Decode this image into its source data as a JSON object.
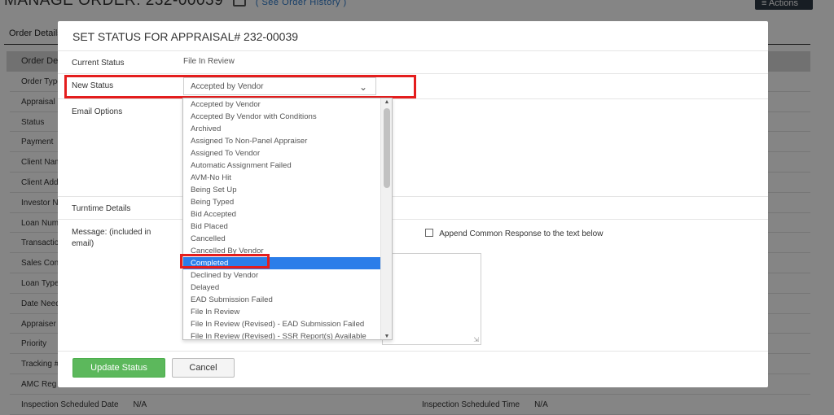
{
  "background": {
    "title": "MANAGE ORDER: 232-00039",
    "see_history": "( See Order History )",
    "actions_label": "≡  Actions",
    "tab": "Order Details",
    "section": "Order Details",
    "rows": [
      {
        "label": "Order Type"
      },
      {
        "label": "Appraisal"
      },
      {
        "label": "Status"
      },
      {
        "label": "Payment"
      },
      {
        "label": "Client Name"
      },
      {
        "label": "Client Address"
      },
      {
        "label": "Investor Name"
      },
      {
        "label": "Loan Number"
      },
      {
        "label": "Transaction"
      },
      {
        "label": "Sales Contract"
      },
      {
        "label": "Loan Type"
      },
      {
        "label": "Date Needed"
      },
      {
        "label": "Appraiser"
      },
      {
        "label": "Priority"
      },
      {
        "label": "Tracking #"
      },
      {
        "label": "AMC Reg"
      },
      {
        "label": "Inspection Scheduled Date",
        "value": "N/A",
        "right_label": "Inspection Scheduled Time",
        "right_value": "N/A"
      }
    ]
  },
  "modal": {
    "title": "SET STATUS FOR APPRAISAL# 232-00039",
    "current_status_label": "Current Status",
    "current_status_value": "File In Review",
    "new_status_label": "New Status",
    "new_status_selected": "Accepted by Vendor",
    "email_options_label": "Email Options",
    "turntime_label": "Turntime Details",
    "message_label": "Message: (included in email)",
    "append_label": "Append Common Response to the text below",
    "update_button": "Update Status",
    "cancel_button": "Cancel"
  },
  "dropdown": {
    "selected_index": 13,
    "options": [
      "Accepted by Vendor",
      "Accepted By Vendor with Conditions",
      "Archived",
      "Assigned To Non-Panel Appraiser",
      "Assigned To Vendor",
      "Automatic Assignment Failed",
      "AVM-No Hit",
      "Being Set Up",
      "Being Typed",
      "Bid Accepted",
      "Bid Placed",
      "Cancelled",
      "Cancelled By Vendor",
      "Completed",
      "Declined by Vendor",
      "Delayed",
      "EAD Submission Failed",
      "File In Review",
      "File In Review (Revised) - EAD Submission Failed",
      "File In Review (Revised) - SSR Report(s) Available"
    ]
  },
  "colors": {
    "highlight": "#e41d1d",
    "selected": "#2b7de9",
    "update_button": "#5cb85c"
  }
}
